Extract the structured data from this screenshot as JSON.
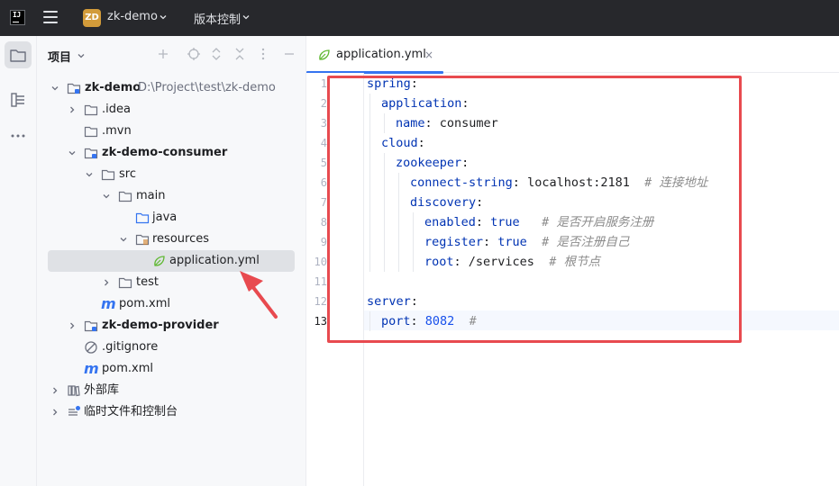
{
  "titlebar": {
    "logo_text": "IJ",
    "project_badge": "ZD",
    "project_name": "zk-demo",
    "vcs_menu": "版本控制"
  },
  "panel": {
    "title": "项目"
  },
  "tree": [
    {
      "label": "zk-demo",
      "path": "D:\\Project\\test\\zk-demo"
    },
    {
      "label": ".idea"
    },
    {
      "label": ".mvn"
    },
    {
      "label": "zk-demo-consumer"
    },
    {
      "label": "src"
    },
    {
      "label": "main"
    },
    {
      "label": "java"
    },
    {
      "label": "resources"
    },
    {
      "label": "application.yml"
    },
    {
      "label": "test"
    },
    {
      "label": "pom.xml"
    },
    {
      "label": "zk-demo-provider"
    },
    {
      "label": ".gitignore"
    },
    {
      "label": "pom.xml"
    },
    {
      "label": "外部库"
    },
    {
      "label": "临时文件和控制台"
    }
  ],
  "editor": {
    "tab_label": "application.yml",
    "tab_close": "×",
    "line_numbers": [
      "1",
      "2",
      "3",
      "4",
      "5",
      "6",
      "7",
      "8",
      "9",
      "10",
      "11",
      "12",
      "13"
    ],
    "current_line": 13,
    "code": {
      "l1_key": "spring",
      "l2_key": "application",
      "l3_key": "name",
      "l3_val": "consumer",
      "l4_key": "cloud",
      "l5_key": "zookeeper",
      "l6_key": "connect-string",
      "l6_val": "localhost:2181",
      "l6_comment": "# 连接地址",
      "l7_key": "discovery",
      "l8_key": "enabled",
      "l8_val": "true",
      "l8_comment": "# 是否开启服务注册",
      "l9_key": "register",
      "l9_val": "true",
      "l9_comment": "# 是否注册自己",
      "l10_key": "root",
      "l10_val": "/services",
      "l10_comment": "# 根节点",
      "l12_key": "server",
      "l13_key": "port",
      "l13_val": "8082",
      "l13_comment": "#"
    }
  },
  "colors": {
    "accent": "#3574f0",
    "highlight_box": "#e84a4f",
    "yaml_key": "#0033b3",
    "yaml_number": "#1750eb",
    "comment": "#8c8c8c"
  }
}
